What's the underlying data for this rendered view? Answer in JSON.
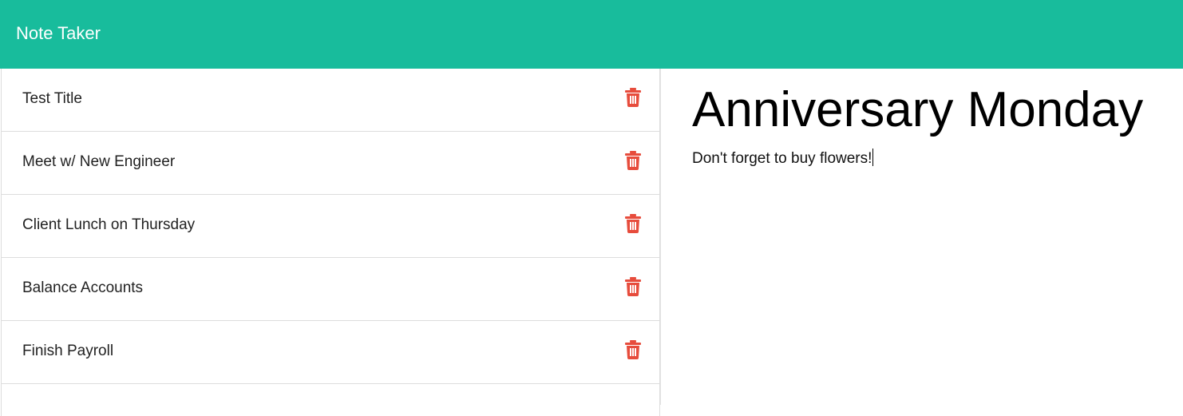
{
  "app": {
    "brand": "Note Taker"
  },
  "notes": [
    {
      "title": "Test Title"
    },
    {
      "title": "Meet w/ New Engineer"
    },
    {
      "title": "Client Lunch on Thursday"
    },
    {
      "title": "Balance Accounts"
    },
    {
      "title": "Finish Payroll"
    }
  ],
  "active_note": {
    "title": "Anniversary Monday",
    "text": "Don't forget to buy flowers!"
  },
  "colors": {
    "navbar": "#18bc9c",
    "trash_icon": "#e74c3c"
  },
  "icons": {
    "delete": "trash-icon"
  }
}
